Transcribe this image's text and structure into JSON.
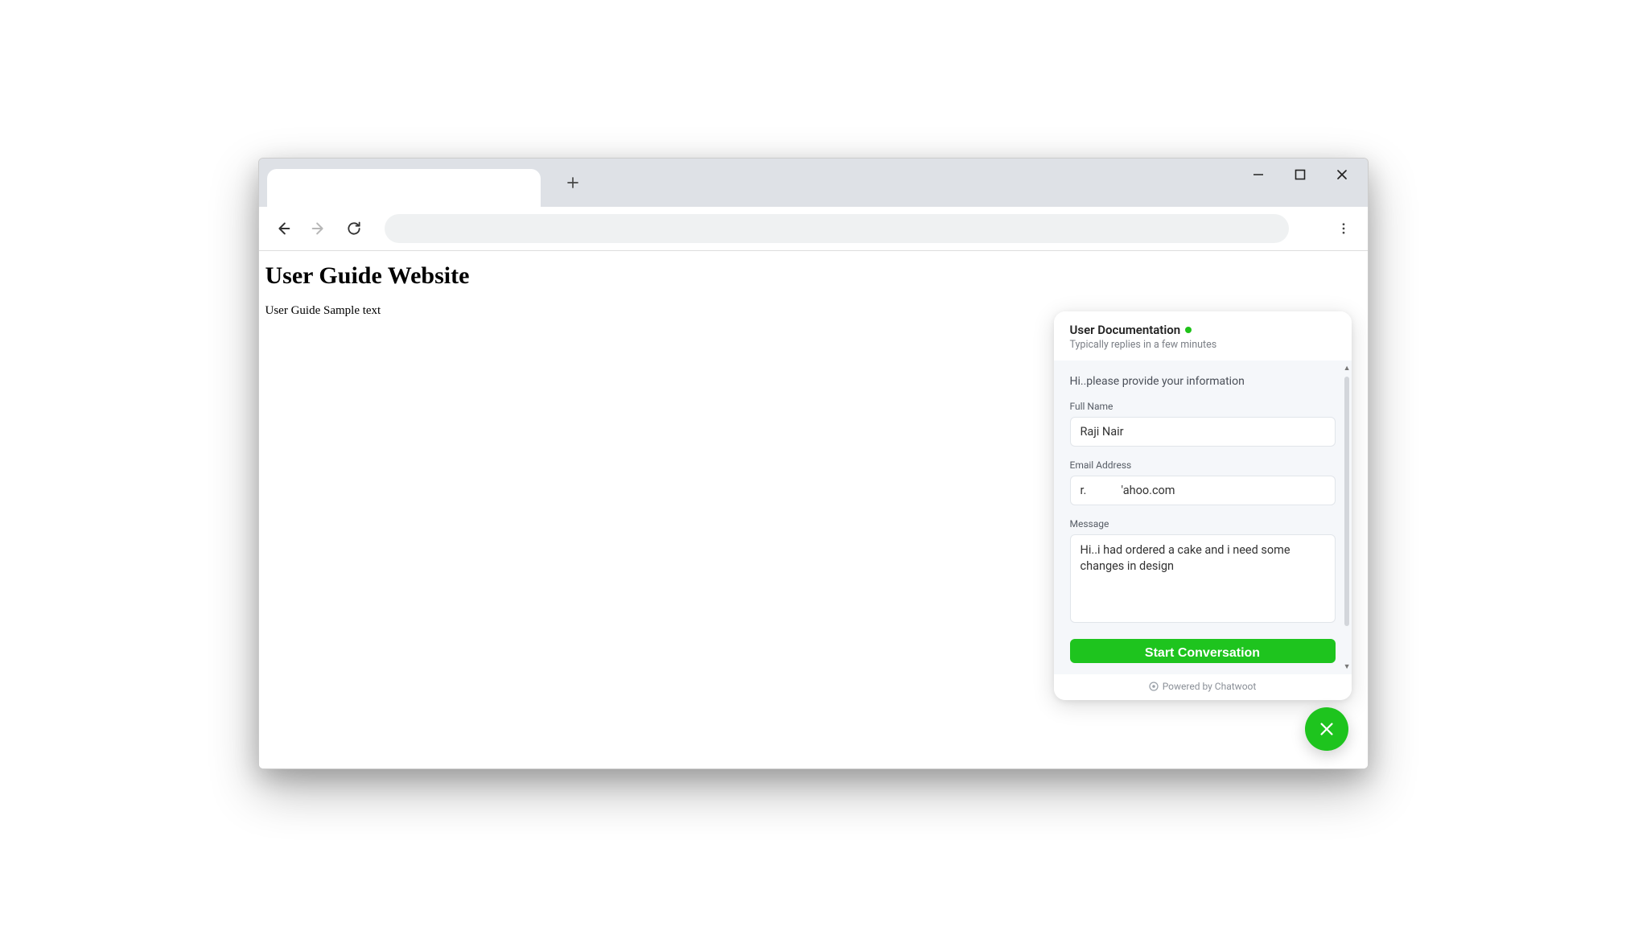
{
  "page": {
    "heading": "User Guide Website",
    "body_text": "User Guide Sample text"
  },
  "chat": {
    "title": "User Documentation",
    "subtitle": "Typically replies in a few minutes",
    "intro": "Hi..please provide your information",
    "fields": {
      "full_name": {
        "label": "Full Name",
        "value": "Raji Nair"
      },
      "email": {
        "label": "Email Address",
        "value": "r.            'ahoo.com"
      },
      "message": {
        "label": "Message",
        "value": "Hi..i had ordered a cake and i need some changes in design"
      }
    },
    "submit_label": "Start Conversation",
    "footer": "Powered by Chatwoot"
  }
}
